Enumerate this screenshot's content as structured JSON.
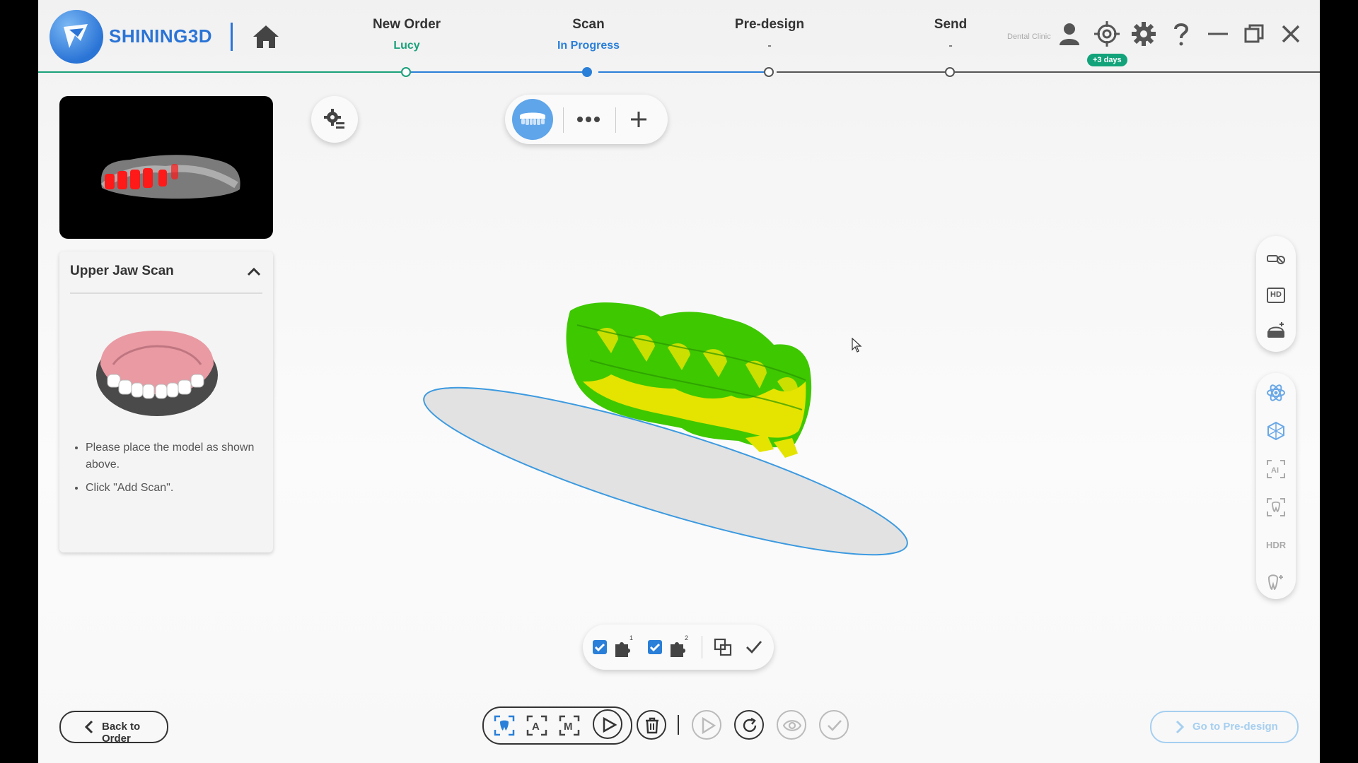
{
  "header": {
    "brand": "SHINING3D",
    "steps": [
      {
        "title": "New Order",
        "status": "Lucy",
        "status_color": "#1aa07a"
      },
      {
        "title": "Scan",
        "status": "In Progress",
        "status_color": "#2a7fd8"
      },
      {
        "title": "Pre-design",
        "status": "-",
        "status_color": "#777777"
      },
      {
        "title": "Send",
        "status": "-",
        "status_color": "#777777"
      }
    ],
    "clinic": "Dental Clinic",
    "days_badge": "+3 days",
    "icons": [
      "home-icon",
      "user-icon",
      "crosshair-icon",
      "gear-icon",
      "help-icon",
      "minimize-icon",
      "restore-icon",
      "close-icon"
    ]
  },
  "instructions": {
    "title": "Upper Jaw Scan",
    "items": [
      "Please place the model as shown above.",
      "Click \"Add Scan\"."
    ]
  },
  "toolbar_top": {
    "icons": [
      "scan-settings-icon",
      "upper-jaw-icon",
      "more-icon",
      "add-icon"
    ]
  },
  "right_toolbar": {
    "group1": [
      "texture-icon",
      "hd-icon",
      "scanner-table-icon"
    ],
    "group2": [
      "atom-icon",
      "hex-network-icon",
      "ai-icon",
      "tooth-frame-icon",
      "hdr-icon",
      "tooth-sparkle-icon"
    ],
    "hdr_label": "HDR",
    "hd_label": "HD"
  },
  "bottom_toolbar": {
    "back_label": "Back to Order",
    "next_label": "Go to Pre-design",
    "check1_checked": true,
    "check2_checked": true,
    "piece1_index": "1",
    "piece2_index": "2"
  },
  "colors": {
    "accent": "#2a7fd8",
    "teal": "#1aa07a",
    "mesh_green": "#3ec800",
    "mesh_yellow": "#e6e600"
  }
}
